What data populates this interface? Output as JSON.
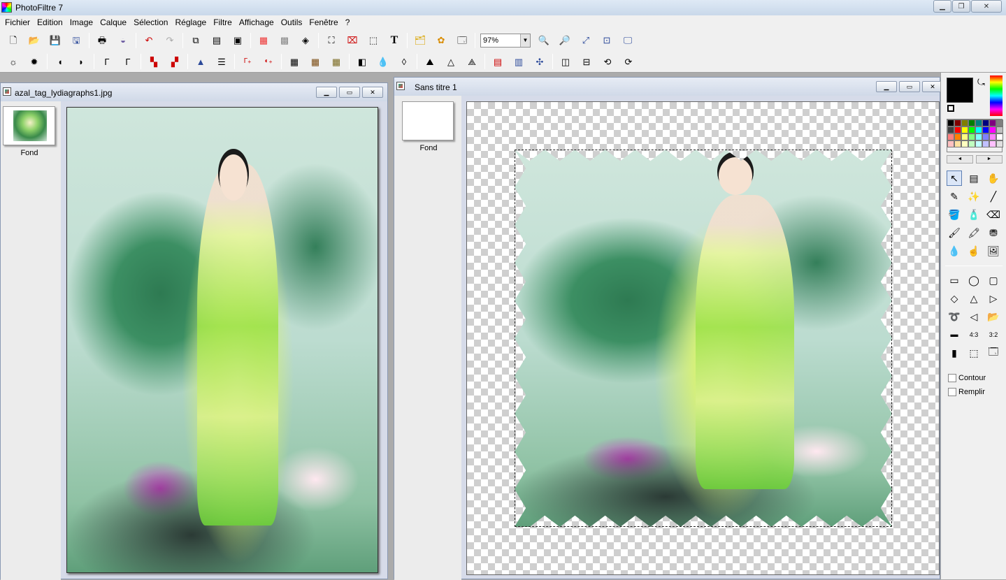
{
  "app": {
    "title": "PhotoFiltre 7"
  },
  "menu": [
    "Fichier",
    "Edition",
    "Image",
    "Calque",
    "Sélection",
    "Réglage",
    "Filtre",
    "Affichage",
    "Outils",
    "Fenêtre",
    "?"
  ],
  "zoom": {
    "value": "97%"
  },
  "doc1": {
    "title": "azal_tag_lydiagraphs1.jpg",
    "layer_label": "Fond"
  },
  "doc2": {
    "title": "Sans titre 1",
    "layer_label": "Fond"
  },
  "colors": {
    "foreground": "#000000",
    "background": "#ffffff"
  },
  "palette": [
    "#000000",
    "#7f0000",
    "#7f7f00",
    "#007f00",
    "#007f7f",
    "#00007f",
    "#7f007f",
    "#7f7f7f",
    "#404040",
    "#ff0000",
    "#ffff00",
    "#00ff00",
    "#00ffff",
    "#0000ff",
    "#ff00ff",
    "#c0c0c0",
    "#ff8080",
    "#ff8000",
    "#ffff80",
    "#80ff80",
    "#80ffff",
    "#8080ff",
    "#ff80ff",
    "#ffffff",
    "#ffc0c0",
    "#ffe0a0",
    "#ffffc0",
    "#c0ffc0",
    "#c0ffff",
    "#c0c0ff",
    "#ffc0ff",
    "#e0e0e0"
  ],
  "options": {
    "contour": "Contour",
    "fill": "Remplir"
  }
}
